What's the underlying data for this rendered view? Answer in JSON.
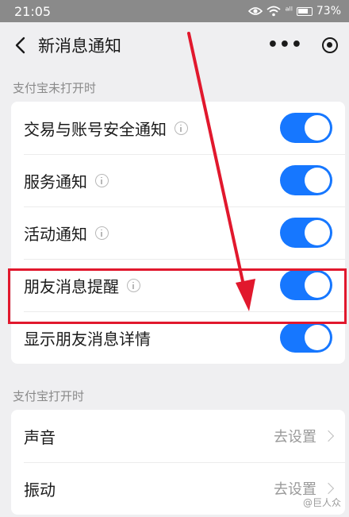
{
  "status_bar": {
    "time": "21:05",
    "signal": "ᵃˡˡ",
    "battery": "73%"
  },
  "nav": {
    "title": "新消息通知",
    "more": "•••"
  },
  "section1": {
    "header": "支付宝未打开时",
    "items": [
      {
        "label": "交易与账号安全通知",
        "info": true,
        "toggle": "on"
      },
      {
        "label": "服务通知",
        "info": true,
        "toggle": "on"
      },
      {
        "label": "活动通知",
        "info": true,
        "toggle": "on"
      },
      {
        "label": "朋友消息提醒",
        "info": true,
        "toggle": "on"
      },
      {
        "label": "显示朋友消息详情",
        "info": false,
        "toggle": "on"
      }
    ]
  },
  "section2": {
    "header": "支付宝打开时",
    "items": [
      {
        "label": "声音",
        "value": "去设置"
      },
      {
        "label": "振动",
        "value": "去设置"
      }
    ]
  },
  "watermark": "@巨人众",
  "colors": {
    "toggle_on": "#1677ff",
    "annotation_red": "#e1182d"
  }
}
